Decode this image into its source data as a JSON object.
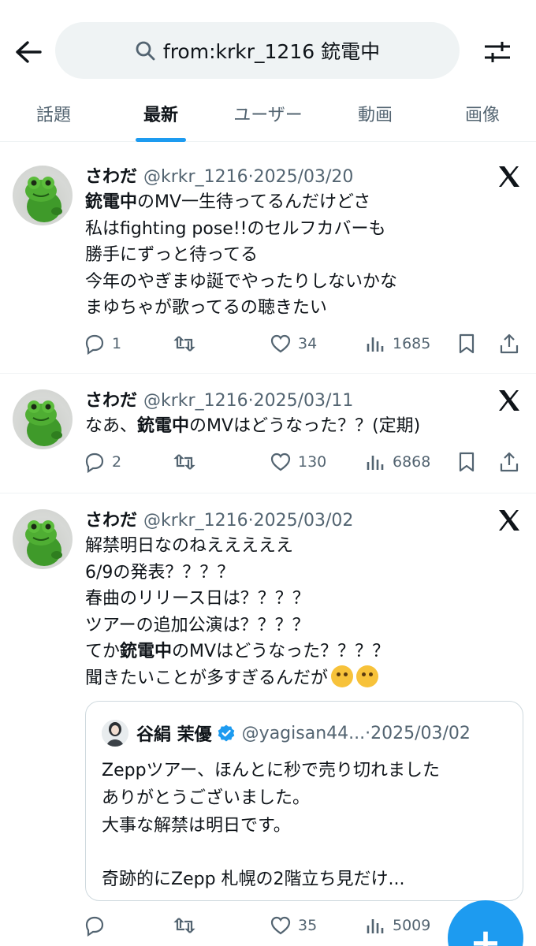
{
  "search": {
    "query": "from:krkr_1216 銃電中"
  },
  "tabs": [
    {
      "label": "話題"
    },
    {
      "label": "最新"
    },
    {
      "label": "ユーザー"
    },
    {
      "label": "動画"
    },
    {
      "label": "画像"
    }
  ],
  "tweets": [
    {
      "name": "さわだ",
      "handle": "@krkr_1216",
      "date": "2025/03/20",
      "lines": [
        "銃電中のMV一生待ってるんだけどさ",
        "私はfighting pose!!のセルフカバーも",
        "勝手にずっと待ってる",
        "今年のやぎまゆ誕でやったりしないかな",
        "まゆちゃが歌ってるの聴きたい"
      ],
      "replies": "1",
      "retweets": "",
      "likes": "34",
      "views": "1685"
    },
    {
      "name": "さわだ",
      "handle": "@krkr_1216",
      "date": "2025/03/11",
      "lines": [
        "なあ、銃電中のMVはどうなった？？(定期)"
      ],
      "replies": "2",
      "retweets": "",
      "likes": "130",
      "views": "6868"
    },
    {
      "name": "さわだ",
      "handle": "@krkr_1216",
      "date": "2025/03/02",
      "lines": [
        "解禁明日なのねえええええ",
        "6/9の発表？？？？",
        "春曲のリリース日は？？？？",
        "ツアーの追加公演は？？？？",
        "てか銃電中のMVはどうなった？？？？",
        "聞きたいことが多すぎるんだが"
      ],
      "replies": "",
      "retweets": "",
      "likes": "35",
      "views": "5009",
      "quote": {
        "name": "谷絹 茉優",
        "handle": "@yagisan44...",
        "date": "2025/03/02",
        "lines": [
          "Zeppツアー、ほんとに秒で売り切れました",
          "ありがとうございました。",
          "大事な解禁は明日です。",
          "",
          "奇跡的にZepp 札幌の2階立ち見だけ..."
        ]
      }
    }
  ],
  "dot": "·",
  "fab_label": "+",
  "colors": {
    "accent": "#1d9bf0",
    "secondary_text": "#536471",
    "border": "#eff3f4"
  }
}
